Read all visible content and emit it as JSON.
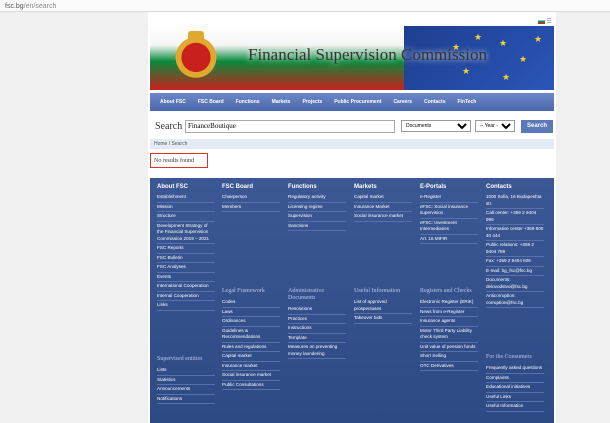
{
  "url": {
    "host": "fsc.bg",
    "path": "/en/search"
  },
  "banner": {
    "title": "Financial Supervision Commission"
  },
  "nav": [
    "About FSC",
    "FSC Board",
    "Functions",
    "Markets",
    "Projects",
    "Public Procurement",
    "Careers",
    "Contacts",
    "FinTech"
  ],
  "search": {
    "label": "Search",
    "value": "FinanceBoutique",
    "doc_option": "Documents",
    "year_option": "-- Year --",
    "button": "Search"
  },
  "breadcrumb": "Home / Search",
  "no_results": "No results found",
  "footer": {
    "about": {
      "title": "About FSC",
      "items": [
        "Establishment",
        "Mission",
        "Structure",
        "Development Strategy of the Financial Supervision Commission 2019 – 2021",
        "FSC Reports",
        "FSC Bulletin",
        "FSC Analyses",
        "Events",
        "International Cooperation",
        "Internal Cooperation",
        "Links"
      ],
      "sub": "Supervised entities",
      "sub_items": [
        "Lists",
        "Statistics",
        "Announcements",
        "Notifications"
      ]
    },
    "board": {
      "title": "FSC Board",
      "items": [
        "Chairperson",
        "Members"
      ],
      "sub": "Legal Framework",
      "sub_items": [
        "Codes",
        "Laws",
        "Ordinances",
        "Guidelines & Recommendations",
        "Rules and regulations",
        "Capital market",
        "Insurance market",
        "Social insurance market",
        "Public Consultations"
      ]
    },
    "functions": {
      "title": "Functions",
      "items": [
        "Regulatory activity",
        "Licensing regime",
        "Supervision",
        "Sanctions"
      ],
      "sub": "Administrative Documents",
      "sub_items": [
        "Resolutions",
        "Practices",
        "Instructions",
        "Template",
        "Measures on preventing money laundering"
      ]
    },
    "markets": {
      "title": "Markets",
      "items": [
        "Capital market",
        "Insurance Market",
        "Social insurance market"
      ],
      "sub": "Useful Information",
      "sub_items": [
        "List of approved prospectuses",
        "Takeover bids"
      ]
    },
    "eportals": {
      "title": "E-Portals",
      "items": [
        "e-Register",
        "eFSC: Social insurance supervision",
        "eFSC: Investment Intermediaries",
        "Art. 16 MIFIR"
      ],
      "sub": "Registers and Checks",
      "sub_items": [
        "Electronic Register (ERiK)",
        "News from e-Register",
        "Insurance agents",
        "Motor Third Party Liability check system",
        "Unit value of pension funds",
        "Short Selling",
        "OTC Derivatives"
      ]
    },
    "contacts": {
      "title": "Contacts",
      "items": [
        "1000 Sofia, 16 Budapeshta str.",
        "Call center: +359 2 9404 999",
        "Informative center +359 800 40 444",
        "Public relations: +359 2 9404 789",
        "Fax: +359 2 9404 606",
        "E-mail: bg_fsc@fsc.bg",
        "Documents: delovodstvo@fsc.bg",
        "Anticorruption: corruption@fsc.bg"
      ],
      "sub": "For the Consumers",
      "sub_items": [
        "Frequently asked questions",
        "Complaints",
        "Educational initiatives",
        "Useful Links",
        "Useful Information"
      ]
    }
  }
}
